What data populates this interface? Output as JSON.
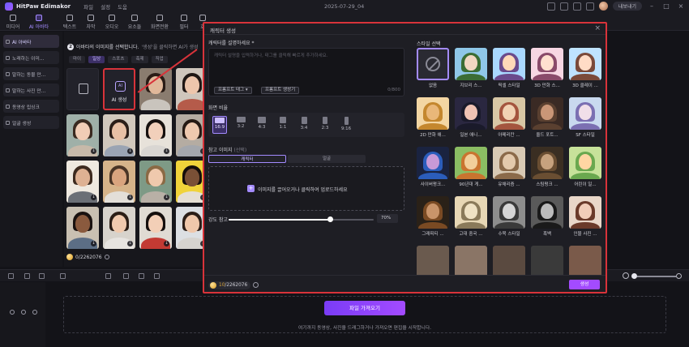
{
  "app": {
    "name": "HitPaw Edimakor",
    "menu": [
      "파일",
      "설정",
      "도움"
    ],
    "doc_title": "2025-07-29_04",
    "upgrade_label": "내보내기"
  },
  "toolbar": {
    "tools": [
      {
        "label": "미디어",
        "icon": "media-icon"
      },
      {
        "label": "AI 아바타",
        "icon": "ai-avatar-icon",
        "active": true
      },
      {
        "label": "텍스트",
        "icon": "text-icon"
      },
      {
        "label": "자막",
        "icon": "subtitle-icon"
      },
      {
        "label": "오디오",
        "icon": "audio-icon"
      },
      {
        "label": "요소들",
        "icon": "elements-icon"
      },
      {
        "label": "화면전환",
        "icon": "transition-icon"
      },
      {
        "label": "필터",
        "icon": "filter-icon"
      },
      {
        "label": "효",
        "icon": "effect-icon"
      }
    ]
  },
  "sidebar": {
    "items": [
      {
        "label": "AI 아바타",
        "active": true
      },
      {
        "label": "노래하는 이미...",
        "active": false
      },
      {
        "label": "말하는 동물 만...",
        "active": false
      },
      {
        "label": "말하는 사진 만...",
        "active": false
      },
      {
        "label": "동영상 립싱크",
        "active": false
      },
      {
        "label": "얼굴 생성",
        "active": false
      }
    ]
  },
  "panel": {
    "step": "2",
    "heading": "아바타의 이미지를 선택합니다.",
    "hint": "'생성'을 클릭하면 AI가 생성",
    "categories": [
      "마이",
      "일상",
      "스포츠",
      "축제",
      "직업"
    ],
    "active_category": "일상",
    "ai_card_label": "AI 생성",
    "credits": "0/2262076"
  },
  "dialog": {
    "title": "캐릭터 생성",
    "prompt_label": "캐릭터를 설명하세요 *",
    "prompt_placeholder": "캐릭터 설명을 입력하거나, 태그를 클릭해 빠르게 추가하세요.",
    "prompt_tag_btn": "프롬프트 태그",
    "prompt_gen_btn": "프롬프트 생성기",
    "prompt_count": "0/800",
    "ratio_label": "화면 비율",
    "ratios": [
      "16:9",
      "3:2",
      "4:3",
      "1:1",
      "3:4",
      "2:3",
      "9:16"
    ],
    "active_ratio": "16:9",
    "ref_label": "참고 이미지",
    "ref_optional": "(선택)",
    "ref_tabs": [
      "캐릭터",
      "얼굴"
    ],
    "upload_text": "이미지를 끌어오거나 클릭하여 업로드하세요",
    "strength_label": "강도 참고",
    "strength_value": "70%",
    "strength_fraction": 0.7,
    "style_label": "스타일 선택",
    "styles": [
      "없음",
      "지브리 스...",
      "픽셀 스타일",
      "3D 만화 스...",
      "3D 클레이 ...",
      "2D 만화 애...",
      "일본 애니...",
      "아메리칸 ...",
      "올드 포트...",
      "SF 스타일",
      "사이버펑크...",
      "90년대 게...",
      "유채리즘 ...",
      "스팀펑크 ...",
      "어린이 일...",
      "그래피티 ...",
      "고대 중국 ...",
      "수묵 스타일",
      "흑백",
      "인물 사진 ..."
    ],
    "credits_used": "10",
    "credits_total": "/2262076",
    "generate_label": "생성"
  },
  "timeline": {
    "import_label": "파일 가져오기",
    "hint": "여기까지 동영상, 사진을 드래그하거나 가져오면 편집을 시작합니다."
  },
  "colors": {
    "accent": "#a48bff",
    "primary_button": "#a34bff",
    "highlight_border": "#d8333a"
  }
}
